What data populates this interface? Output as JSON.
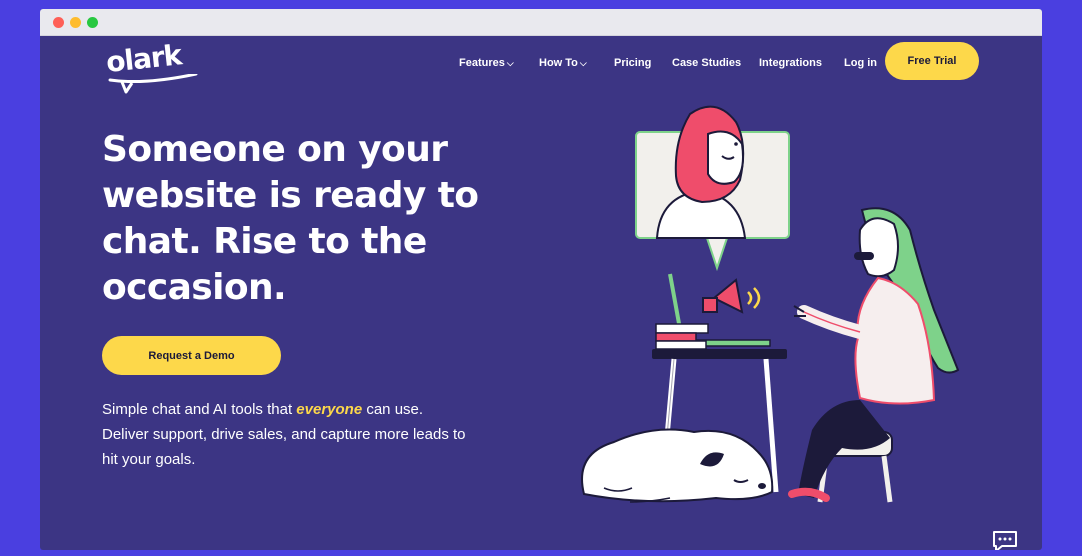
{
  "brand": {
    "logo_text": "olark"
  },
  "nav": {
    "items": [
      {
        "label": "Features",
        "chevron": true
      },
      {
        "label": "How To",
        "chevron": true
      },
      {
        "label": "Pricing",
        "chevron": false
      },
      {
        "label": "Case Studies",
        "chevron": false
      },
      {
        "label": "Integrations",
        "chevron": false
      },
      {
        "label": "Log in",
        "chevron": false
      }
    ],
    "cta_label": "Free Trial"
  },
  "hero": {
    "headline": "Someone on your website is ready to chat. Rise to the occasion.",
    "cta_label": "Request a Demo",
    "subtext_before": "Simple chat and AI tools that ",
    "subtext_emphasis": "everyone",
    "subtext_after": " can use. Deliver support, drive sales, and capture more leads to hit your goals."
  },
  "icons": {
    "chevron": "chevron-down-icon",
    "chat_widget": "chat-bubble-icon"
  },
  "colors": {
    "background": "#3c3584",
    "outer": "#4a3fe0",
    "accent": "#fdd84a",
    "text": "#ffffff"
  }
}
